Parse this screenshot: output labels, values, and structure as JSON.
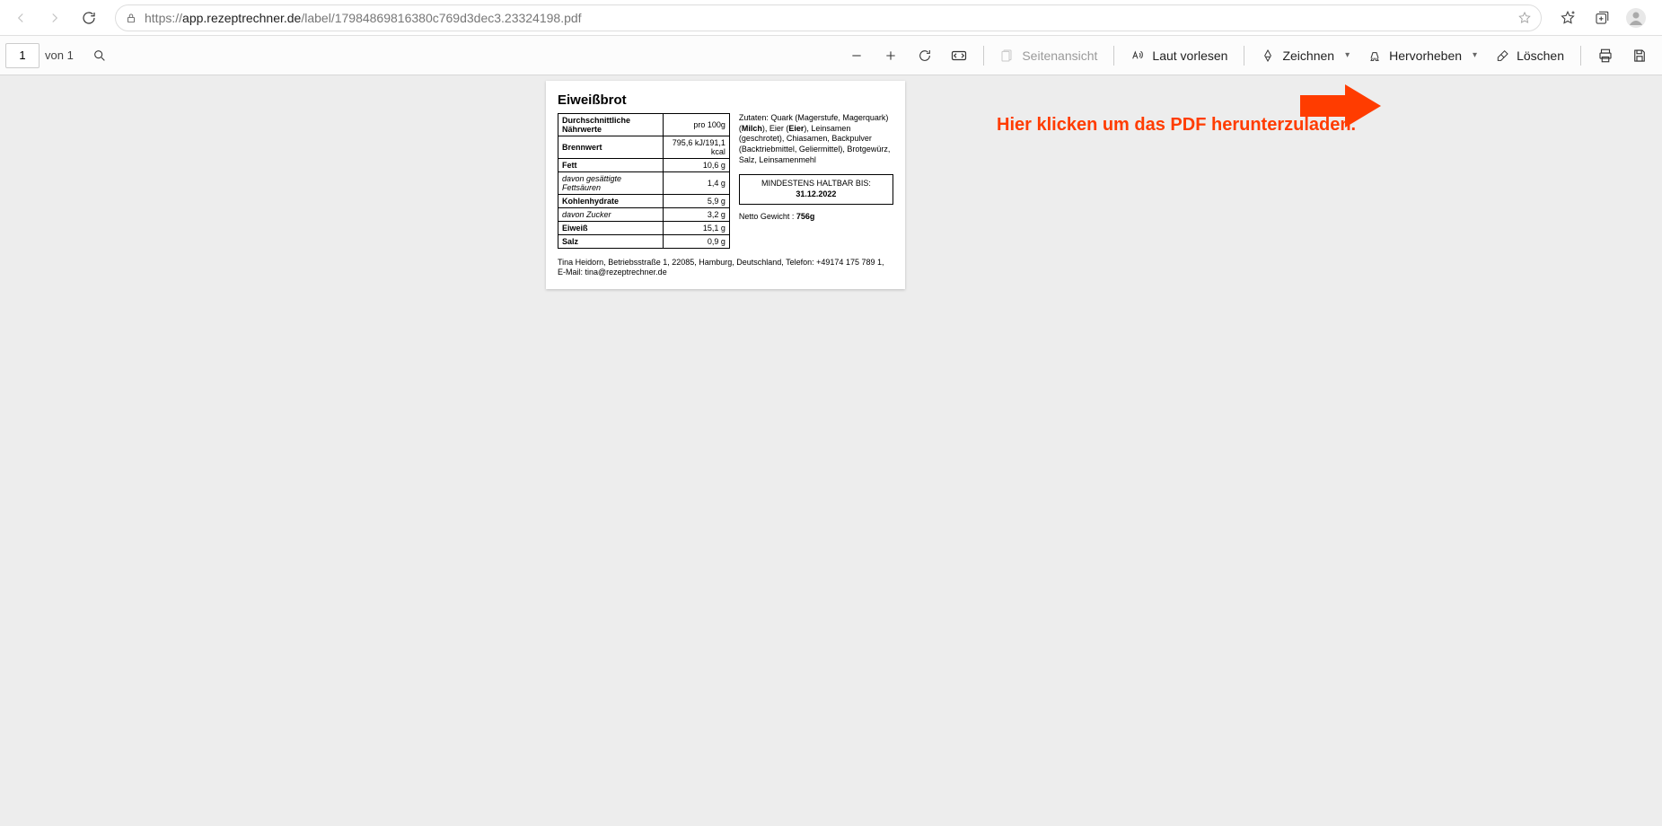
{
  "browser": {
    "url_prefix": "https://",
    "url_host": "app.rezeptrechner.de",
    "url_path": "/label/17984869816380c769d3dec3.23324198.pdf"
  },
  "pdf_toolbar": {
    "page_current": "1",
    "page_of_label": "von 1",
    "page_view_label": "Seitenansicht",
    "read_aloud_label": "Laut vorlesen",
    "draw_label": "Zeichnen",
    "highlight_label": "Hervorheben",
    "erase_label": "Löschen"
  },
  "label": {
    "title": "Eiweißbrot",
    "table_header_left": "Durchschnittliche Nährwerte",
    "table_header_right": "pro 100g",
    "rows": [
      {
        "name": "Brennwert",
        "value": "795,6 kJ/191,1 kcal",
        "bold": true
      },
      {
        "name": "Fett",
        "value": "10,6 g",
        "bold": true
      },
      {
        "name": "davon gesättigte Fettsäuren",
        "value": "1,4 g",
        "italic": true
      },
      {
        "name": "Kohlenhydrate",
        "value": "5,9 g",
        "bold": true
      },
      {
        "name": "davon Zucker",
        "value": "3,2 g",
        "italic": true
      },
      {
        "name": "Eiweiß",
        "value": "15,1 g",
        "bold": true
      },
      {
        "name": "Salz",
        "value": "0,9 g",
        "bold": true
      }
    ],
    "ingredients_label": "Zutaten:",
    "ingredients_parts": [
      {
        "text": " Quark (Magerstufe, Magerquark) ("
      },
      {
        "text": "Milch",
        "bold": true
      },
      {
        "text": "), Eier ("
      },
      {
        "text": "Eier",
        "bold": true
      },
      {
        "text": "), Leinsamen (geschrotet), Chiasamen, Backpulver (Backtriebmittel, Geliermittel), Brotgewürz, Salz, Leinsamenmehl"
      }
    ],
    "best_before_label": "MINDESTENS HALTBAR BIS:",
    "best_before_date": "31.12.2022",
    "net_weight_label": "Netto Gewicht :",
    "net_weight_value": "756g",
    "footer": "Tina Heidorn, Betriebsstraße 1, 22085, Hamburg, Deutschland, Telefon: +49174 175 789 1, E-Mail: tina@rezeptrechner.de"
  },
  "annotation": {
    "text": "Hier klicken um das PDF herunterzuladen."
  }
}
